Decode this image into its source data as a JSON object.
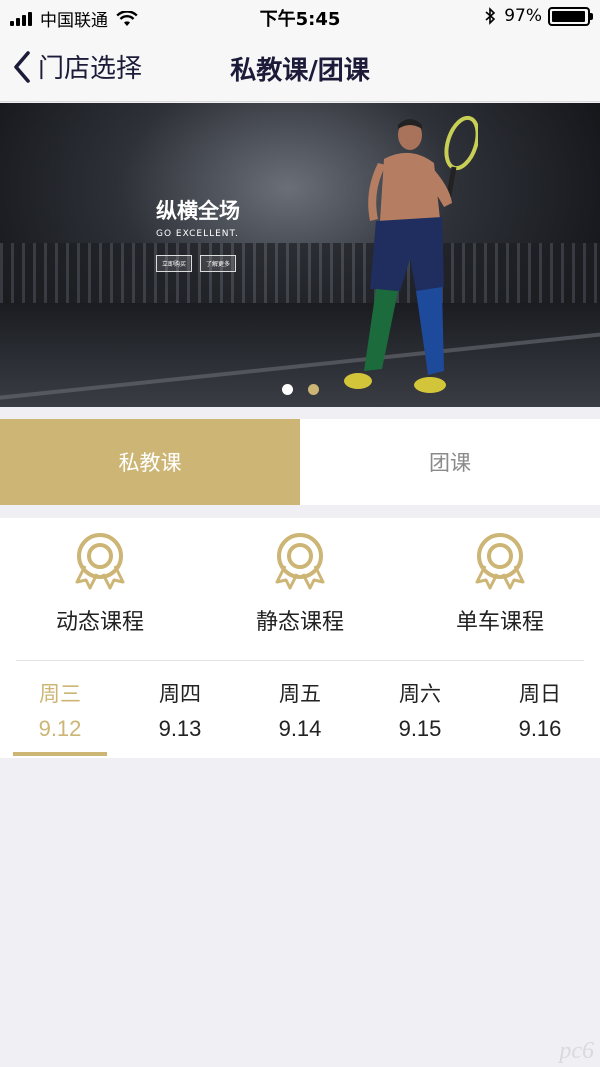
{
  "status_bar": {
    "carrier": "中国联通",
    "time": "下午5:45",
    "battery": "97%",
    "battery_level": 0.97
  },
  "nav": {
    "back_label": "门店选择",
    "title": "私教课/团课"
  },
  "banner": {
    "headline": "纵横全场",
    "subline": "GO EXCELLENT.",
    "button_1": "立即购买",
    "button_2": "了解更多",
    "page_count": 2,
    "active_page": 1
  },
  "tabs": [
    {
      "label": "私教课",
      "active": true
    },
    {
      "label": "团课",
      "active": false
    }
  ],
  "categories": [
    {
      "label": "动态课程",
      "icon": "award-medal-icon"
    },
    {
      "label": "静态课程",
      "icon": "award-medal-icon"
    },
    {
      "label": "单车课程",
      "icon": "award-medal-icon"
    }
  ],
  "days": [
    {
      "weekday": "周三",
      "date": "9.12",
      "active": true
    },
    {
      "weekday": "周四",
      "date": "9.13",
      "active": false
    },
    {
      "weekday": "周五",
      "date": "9.14",
      "active": false
    },
    {
      "weekday": "周六",
      "date": "9.15",
      "active": false
    },
    {
      "weekday": "周日",
      "date": "9.16",
      "active": false
    }
  ],
  "watermark": "pc6",
  "colors": {
    "accent": "#ccb575",
    "nav_text": "#1c1c3a",
    "background": "#efeff4"
  }
}
